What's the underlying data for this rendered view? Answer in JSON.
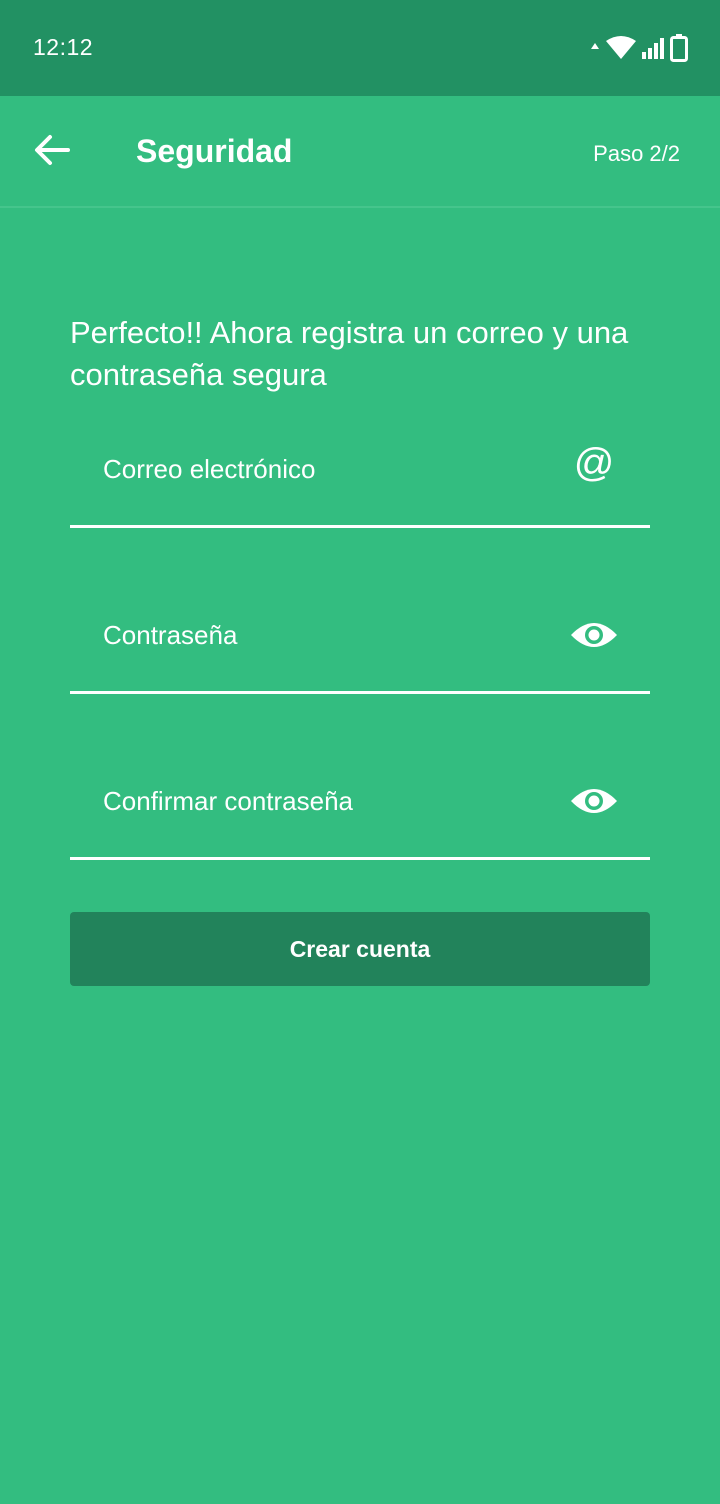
{
  "status_bar": {
    "time": "12:12",
    "icons": [
      "data-arrows-icon",
      "wifi-icon",
      "signal-icon",
      "battery-icon"
    ]
  },
  "app_bar": {
    "back_icon": "arrow-left-icon",
    "title": "Seguridad",
    "step": "Paso 2/2"
  },
  "form": {
    "intro": "Perfecto!! Ahora registra un correo y una contraseña segura",
    "fields": [
      {
        "label": "Correo electrónico",
        "icon": "at-sign-icon",
        "icon_glyph": "@"
      },
      {
        "label": "Contraseña",
        "icon": "eye-icon"
      },
      {
        "label": "Confirmar contraseña",
        "icon": "eye-icon"
      }
    ],
    "submit_label": "Crear cuenta"
  },
  "colors": {
    "background": "#33bd80",
    "status_bar": "#229163",
    "button": "#22835b",
    "text": "#ffffff"
  }
}
